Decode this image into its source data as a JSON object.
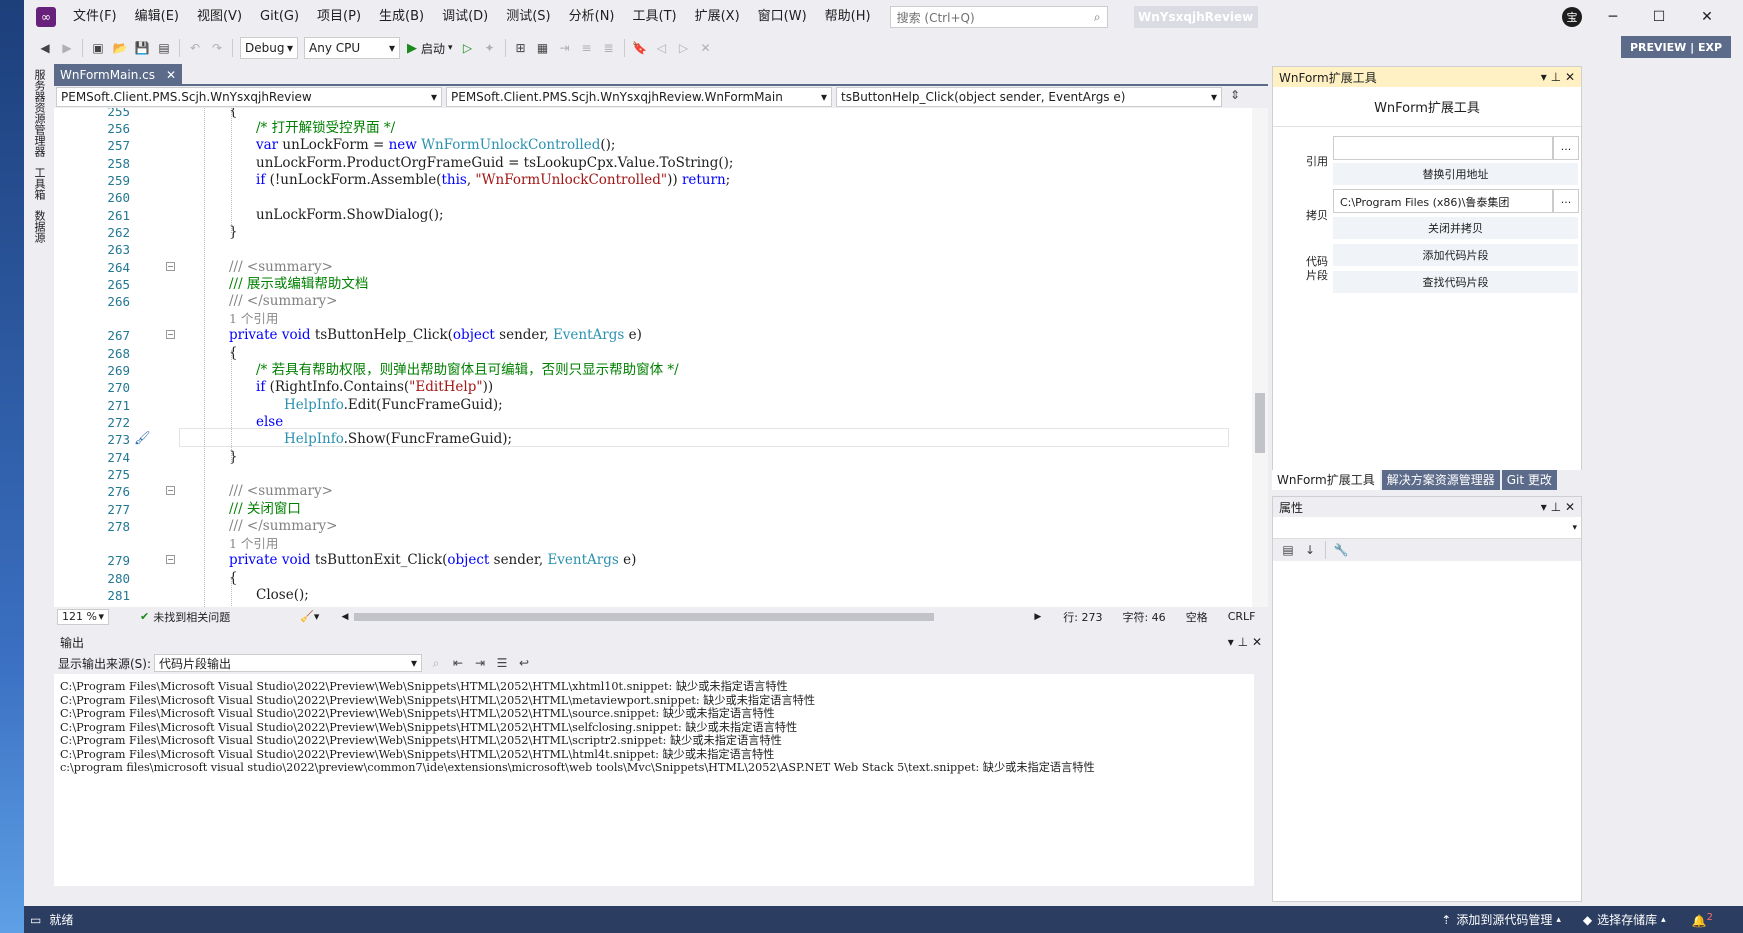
{
  "menu": [
    "文件(F)",
    "编辑(E)",
    "视图(V)",
    "Git(G)",
    "项目(P)",
    "生成(B)",
    "调试(D)",
    "测试(S)",
    "分析(N)",
    "工具(T)",
    "扩展(X)",
    "窗口(W)",
    "帮助(H)"
  ],
  "search": {
    "placeholder": "搜索 (Ctrl+Q)"
  },
  "solution_name": "WnYsxqjhReview",
  "avatar": "宝",
  "toolbar": {
    "config": "Debug",
    "platform": "Any CPU",
    "start": "启动"
  },
  "preview_badge": "PREVIEW | EXP",
  "vtabs": [
    "服务器资源管理器",
    "工具箱",
    "数据源"
  ],
  "doc_tab": "WnFormMain.cs",
  "nav": {
    "project": "PEMSoft.Client.PMS.Scjh.WnYsxqjhReview",
    "class": "PEMSoft.Client.PMS.Scjh.WnYsxqjhReview.WnFormMain",
    "member": "tsButtonHelp_Click(object sender, EventArgs e)"
  },
  "code": {
    "l256c": "/* 打开解锁受控界面 */",
    "l264": "/// <summary>",
    "l265": "/// 展示或编辑帮助文档",
    "l266": "/// </summary>",
    "ref1": "1 个引用",
    "l269": "/* 若具有帮助权限，则弹出帮助窗体且可编辑，否则只显示帮助窗体 */",
    "l277": "/// 关闭窗口",
    "ref2": "1 个引用",
    "str_unlock": "\"WnFormUnlockControlled\"",
    "str_edit": "\"EditHelp\""
  },
  "editor_status": {
    "zoom": "121 %",
    "issues": "未找到相关问题",
    "line": "行: 273",
    "col": "字符: 46",
    "ws": "空格",
    "eol": "CRLF"
  },
  "output": {
    "title": "输出",
    "source_label": "显示输出来源(S):",
    "source": "代码片段输出",
    "lines": [
      "C:\\Program Files\\Microsoft Visual Studio\\2022\\Preview\\Web\\Snippets\\HTML\\2052\\HTML\\xhtml10t.snippet: 缺少或未指定语言特性",
      "C:\\Program Files\\Microsoft Visual Studio\\2022\\Preview\\Web\\Snippets\\HTML\\2052\\HTML\\metaviewport.snippet: 缺少或未指定语言特性",
      "C:\\Program Files\\Microsoft Visual Studio\\2022\\Preview\\Web\\Snippets\\HTML\\2052\\HTML\\source.snippet: 缺少或未指定语言特性",
      "C:\\Program Files\\Microsoft Visual Studio\\2022\\Preview\\Web\\Snippets\\HTML\\2052\\HTML\\selfclosing.snippet: 缺少或未指定语言特性",
      "C:\\Program Files\\Microsoft Visual Studio\\2022\\Preview\\Web\\Snippets\\HTML\\2052\\HTML\\scriptr2.snippet: 缺少或未指定语言特性",
      "C:\\Program Files\\Microsoft Visual Studio\\2022\\Preview\\Web\\Snippets\\HTML\\2052\\HTML\\html4t.snippet: 缺少或未指定语言特性",
      "c:\\program files\\microsoft visual studio\\2022\\preview\\common7\\ide\\extensions\\microsoft\\web tools\\Mvc\\Snippets\\HTML\\2052\\ASP.NET Web Stack 5\\text.snippet: 缺少或未指定语言特性"
    ]
  },
  "ext": {
    "panel_title": "WnForm扩展工具",
    "heading": "WnForm扩展工具",
    "ref_label": "引用",
    "ref_value": "",
    "replace_btn": "替换引用地址",
    "copy_label": "拷贝",
    "copy_value": "C:\\Program Files (x86)\\鲁泰集团",
    "close_copy_btn": "关闭并拷贝",
    "snippet_label": "代码片段",
    "add_snippet_btn": "添加代码片段",
    "find_snippet_btn": "查找代码片段",
    "dots": "..."
  },
  "right_tabs": [
    "WnForm扩展工具",
    "解决方案资源管理器",
    "Git 更改"
  ],
  "props_title": "属性",
  "status": {
    "ready": "就绪",
    "add_source": "添加到源代码管理",
    "select_repo": "选择存储库",
    "notif": "2"
  }
}
